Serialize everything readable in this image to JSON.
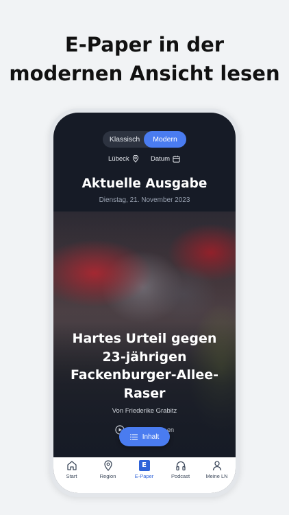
{
  "promo": {
    "line1": "E-Paper in der",
    "line2": "modernen Ansicht lesen"
  },
  "view_toggle": {
    "options": [
      "Klassisch",
      "Modern"
    ],
    "selected": "Modern"
  },
  "filters": {
    "region": "Lübeck",
    "date": "Datum"
  },
  "issue": {
    "title": "Aktuelle Ausgabe",
    "date": "Dienstag, 21. November 2023"
  },
  "article": {
    "title_line1": "Hartes Urteil gegen",
    "title_line2": "23-jährigen",
    "title_line3": "Fackenburger-Allee-",
    "title_line4": "Raser",
    "byline": "Von Friederike Grabitz",
    "audio_partial": "en"
  },
  "fab": {
    "label": "Inhalt"
  },
  "tabbar": {
    "items": [
      {
        "label": "Start",
        "icon": "home-icon"
      },
      {
        "label": "Region",
        "icon": "location-pin-icon"
      },
      {
        "label": "E-Paper",
        "icon": "epaper-icon",
        "glyph": "E"
      },
      {
        "label": "Podcast",
        "icon": "headphones-icon"
      },
      {
        "label": "Meine LN",
        "icon": "user-icon"
      }
    ],
    "active": "E-Paper"
  },
  "colors": {
    "accent": "#4a7cf0",
    "active_tab": "#2f63d8",
    "screen_bg": "#161b26",
    "page_bg": "#f1f3f5"
  }
}
